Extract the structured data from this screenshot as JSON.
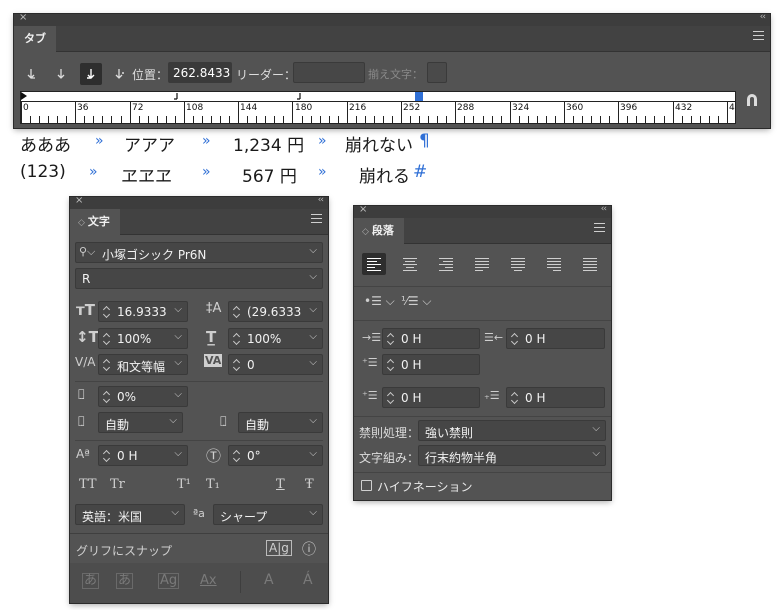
{
  "tabs_panel": {
    "title": "タブ",
    "position_label": "位置：",
    "position_value": "262.8433",
    "leader_label": "リーダー：",
    "leader_value": "",
    "align_label": "揃え文字：",
    "ruler_ticks": [
      "0",
      "36",
      "72",
      "108",
      "144",
      "180",
      "216",
      "252",
      "288",
      "324",
      "360",
      "396",
      "432",
      "4"
    ]
  },
  "document": {
    "line1": [
      "あああ",
      "»",
      "アアア",
      "»",
      "1,234 円",
      "»",
      "崩れない",
      "¶"
    ],
    "line2": [
      "(123)",
      "»",
      "ヱヱヱ",
      "»",
      "567 円",
      "»",
      "崩れる",
      "#"
    ]
  },
  "character_panel": {
    "title": "文字",
    "font_family": "小塚ゴシック Pr6N",
    "font_style": "R",
    "font_size": "16.9333",
    "leading": "(29.6333",
    "vertical_scale": "100%",
    "horizontal_scale": "100%",
    "kerning": "和文等幅",
    "tracking": "0",
    "tsume": "0%",
    "aki_left": "自動",
    "aki_right": "自動",
    "baseline_shift": "0 H",
    "rotation": "0°",
    "style_buttons": [
      "TT",
      "Tr",
      "T¹",
      "T₁",
      "T",
      "Ŧ"
    ],
    "language": "英語：米国",
    "aa_label": "ªa",
    "antialias": "シャープ",
    "snap_label": "グリフにスナップ",
    "snap_icons": [
      "あ",
      "あ",
      "Ag",
      "Ax",
      "A",
      "Á"
    ]
  },
  "paragraph_panel": {
    "title": "段落",
    "left_indent": "0 H",
    "right_indent": "0 H",
    "first_line_indent": "0 H",
    "space_before": "0 H",
    "space_after": "0 H",
    "kinsoku_label": "禁則処理：",
    "kinsoku_value": "強い禁則",
    "mojikumi_label": "文字組み：",
    "mojikumi_value": "行末約物半角",
    "hyphenation_label": "ハイフネーション"
  }
}
